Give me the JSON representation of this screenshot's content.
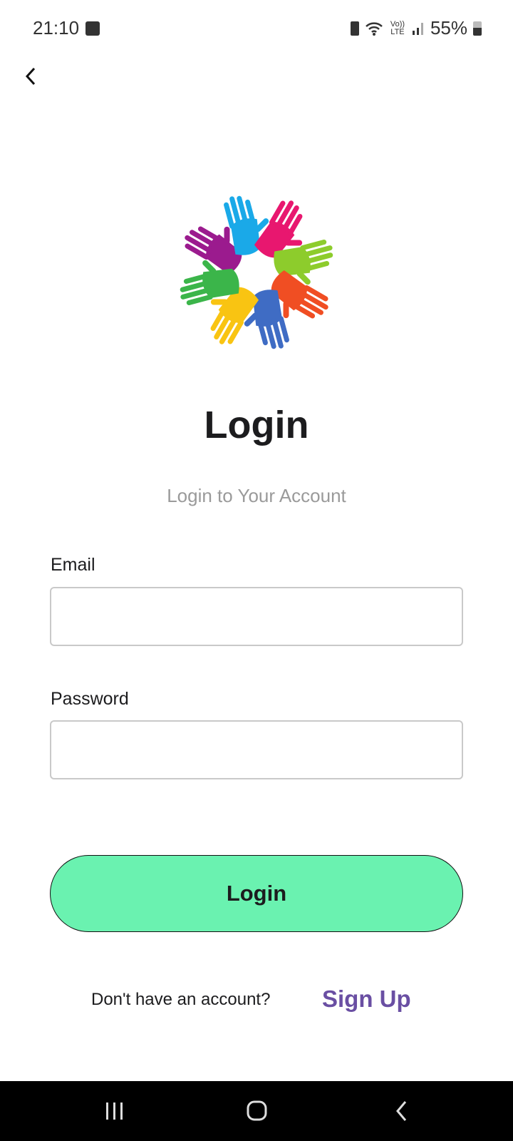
{
  "status_bar": {
    "time": "21:10",
    "network": "Vo)) LTE",
    "battery": "55%"
  },
  "icons": {
    "back": "chevron-left-icon",
    "logo": "hands-circle-logo"
  },
  "logo_colors": [
    "#9b1b8e",
    "#1aa9e8",
    "#e8176f",
    "#8dcc2c",
    "#f04e23",
    "#3f6cc4",
    "#f9c412",
    "#3bb54a"
  ],
  "page": {
    "title": "Login",
    "subtitle": "Login to Your Account"
  },
  "form": {
    "email_label": "Email",
    "email_value": "",
    "password_label": "Password",
    "password_value": "",
    "login_button": "Login"
  },
  "footer": {
    "prompt": "Don't have an account?",
    "signup_link": "Sign Up"
  },
  "colors": {
    "button": "#6af2b0",
    "link": "#6a4fa3"
  }
}
